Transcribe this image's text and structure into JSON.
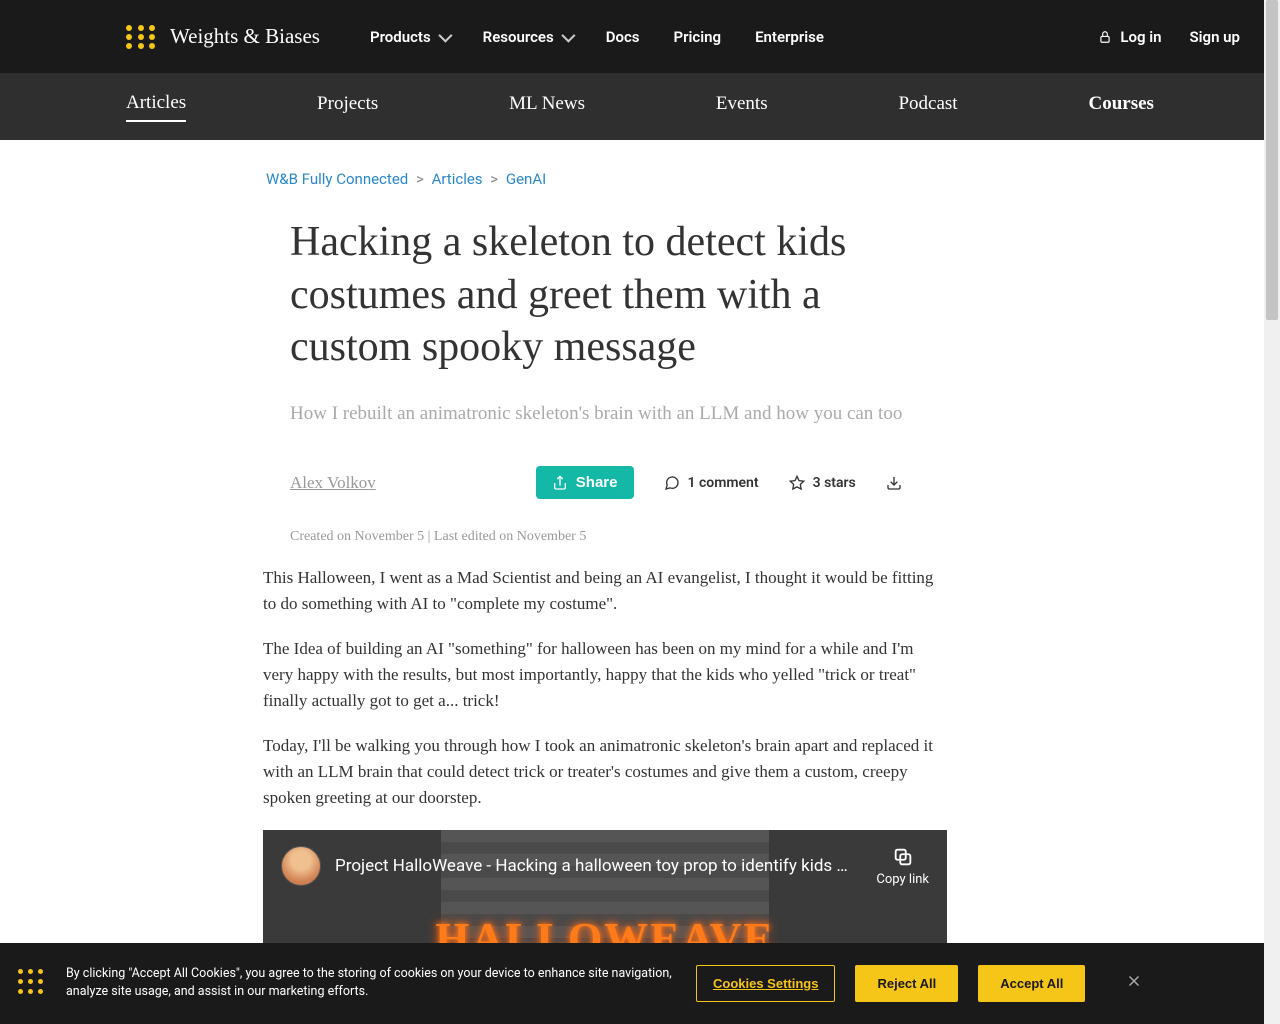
{
  "brand": "Weights & Biases",
  "top_nav": {
    "products": "Products",
    "resources": "Resources",
    "docs": "Docs",
    "pricing": "Pricing",
    "enterprise": "Enterprise"
  },
  "auth": {
    "login": "Log in",
    "signup": "Sign up"
  },
  "sub_nav": {
    "articles": "Articles",
    "projects": "Projects",
    "ml_news": "ML News",
    "events": "Events",
    "podcast": "Podcast",
    "courses": "Courses"
  },
  "breadcrumb": {
    "root": "W&B Fully Connected",
    "l1": "Articles",
    "l2": "GenAI"
  },
  "article": {
    "title": "Hacking a skeleton to detect kids costumes and greet them with a custom spooky message",
    "subtitle": "How I rebuilt an animatronic skeleton's brain with an LLM and how you can too",
    "author": "Alex Volkov",
    "share": "Share",
    "comments": "1 comment",
    "stars": "3 stars",
    "dates": "Created on November 5  |  Last edited on November 5",
    "p1": "This Halloween, I went as a Mad Scientist and being an AI evangelist, I thought it would be fitting to do something with AI to \"complete my costume\".",
    "p2": "The Idea of building an AI \"something\" for halloween has been on my mind for a while and I'm very happy with the results, but most importantly, happy that the kids who yelled \"trick or treat\" finally actually got to get a... trick!",
    "p3": "Today, I'll be walking you through how I took an animatronic skeleton's brain apart and replaced it with an LLM brain that could detect trick or treater's costumes and give them a custom, creepy spoken greeting at our doorstep."
  },
  "video": {
    "title": "Project HalloWeave - Hacking a halloween toy prop to identify kids co…",
    "copy": "Copy link",
    "overlay": "HALLOWEAVE"
  },
  "cookies": {
    "text": "By clicking \"Accept All Cookies\", you agree to the storing of cookies on your device to enhance site navigation, analyze site usage, and assist in our marketing efforts.",
    "settings": "Cookies Settings",
    "reject": "Reject All",
    "accept": "Accept All"
  }
}
